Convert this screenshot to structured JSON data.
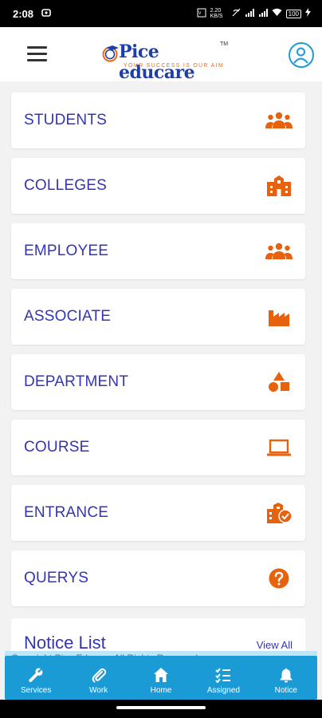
{
  "status_bar": {
    "time": "2:08",
    "network_speed": "2.20 KB/S",
    "battery": "100"
  },
  "header": {
    "logo_text": "Pice educare",
    "logo_tagline": "YOUR SUCCESS IS OUR AIM",
    "logo_tm": "TM"
  },
  "menu": {
    "items": [
      {
        "label": "STUDENTS",
        "icon": "group-icon"
      },
      {
        "label": "COLLEGES",
        "icon": "school-icon"
      },
      {
        "label": "EMPLOYEE",
        "icon": "group-icon"
      },
      {
        "label": "ASSOCIATE",
        "icon": "factory-icon"
      },
      {
        "label": "DEPARTMENT",
        "icon": "category-icon"
      },
      {
        "label": "COURSE",
        "icon": "laptop-icon"
      },
      {
        "label": "ENTRANCE",
        "icon": "verified-school-icon"
      },
      {
        "label": "QUERYS",
        "icon": "help-icon"
      }
    ]
  },
  "notice": {
    "title": "Notice List",
    "view_all": "View All",
    "marquee": "Copyright Pice Educare All Rights Reserved"
  },
  "bottom_nav": {
    "items": [
      {
        "label": "Services",
        "icon": "wrench-icon"
      },
      {
        "label": "Work",
        "icon": "paperclip-icon"
      },
      {
        "label": "Home",
        "icon": "home-icon"
      },
      {
        "label": "Assigned",
        "icon": "checklist-icon"
      },
      {
        "label": "Notice",
        "icon": "bell-icon"
      }
    ]
  },
  "colors": {
    "accent": "#1b9bd6",
    "label": "#3434b4",
    "icon": "#e8610c",
    "background": "#f2f2f2"
  }
}
